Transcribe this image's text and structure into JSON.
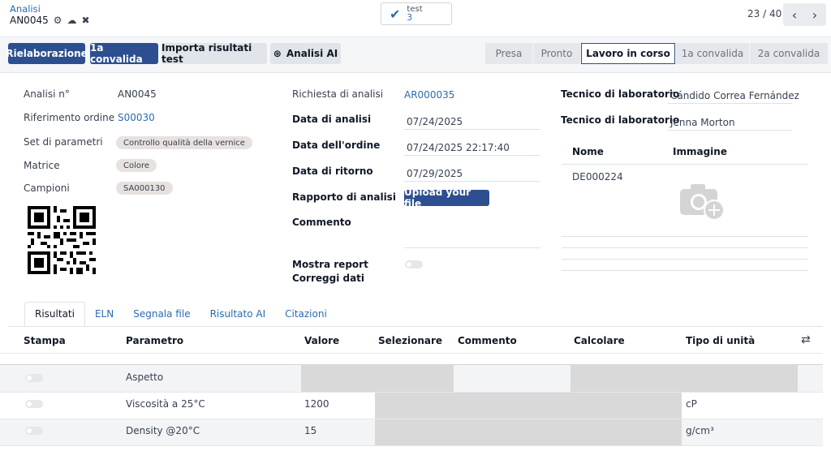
{
  "breadcrumb": {
    "parent": "Analisi",
    "record": "AN0045"
  },
  "stat_button": {
    "label": "test",
    "count": "3"
  },
  "pager": {
    "value": "23 / 40"
  },
  "actions": {
    "rework": "Rielaborazione",
    "first_validation": "1a convalida",
    "import_results": "Importa risultati test",
    "ai_analysis": "Analisi AI"
  },
  "stages": [
    "Presa",
    "Pronto",
    "Lavoro in corso",
    "1a convalida",
    "2a convalida"
  ],
  "active_stage": "Lavoro in corso",
  "left": {
    "analysis_no_label": "Analisi n°",
    "analysis_no": "AN0045",
    "order_ref_label": "Riferimento ordine",
    "order_ref": "S00030",
    "param_set_label": "Set di parametri",
    "param_set": "Controllo qualità della vernice",
    "matrix_label": "Matrice",
    "matrix": "Colore",
    "samples_label": "Campioni",
    "samples": "SA000130"
  },
  "middle": {
    "request_label": "Richiesta di analisi",
    "request": "AR000035",
    "analysis_date_label": "Data di analisi",
    "analysis_date": "07/24/2025",
    "order_date_label": "Data dell'ordine",
    "order_date": "07/24/2025 22:17:40",
    "return_date_label": "Data di ritorno",
    "return_date": "07/29/2025",
    "report_label": "Rapporto di analisi",
    "upload": "Upload your file",
    "comment_label": "Commento",
    "show_report_label": "Mostra report",
    "correct_data_label": "Correggi dati"
  },
  "right": {
    "tech1_label": "Tecnico di laboratorio",
    "tech1": "Cándido Correa Fernández",
    "tech2_label": "Tecnico di laboratorio",
    "tech2": "Jenna Morton",
    "col_name": "Nome",
    "col_image": "Immagine",
    "doc_name": "DE000224"
  },
  "tabs": [
    "Risultati",
    "ELN",
    "Segnala file",
    "Risultato AI",
    "Citazioni"
  ],
  "table": {
    "headers": [
      "Stampa",
      "Parametro",
      "Valore",
      "Selezionare",
      "Commento",
      "Calcolare",
      "Tipo di unità"
    ],
    "rows": [
      {
        "param": "Aspetto",
        "value": "",
        "unit": ""
      },
      {
        "param": "Viscosità a 25°C",
        "value": "1200",
        "unit": "cP"
      },
      {
        "param": "Density @20°C",
        "value": "15",
        "unit": "g/cm³"
      }
    ]
  },
  "colors": {
    "primary": "#2d4f8f",
    "link": "#2b6cb0"
  }
}
